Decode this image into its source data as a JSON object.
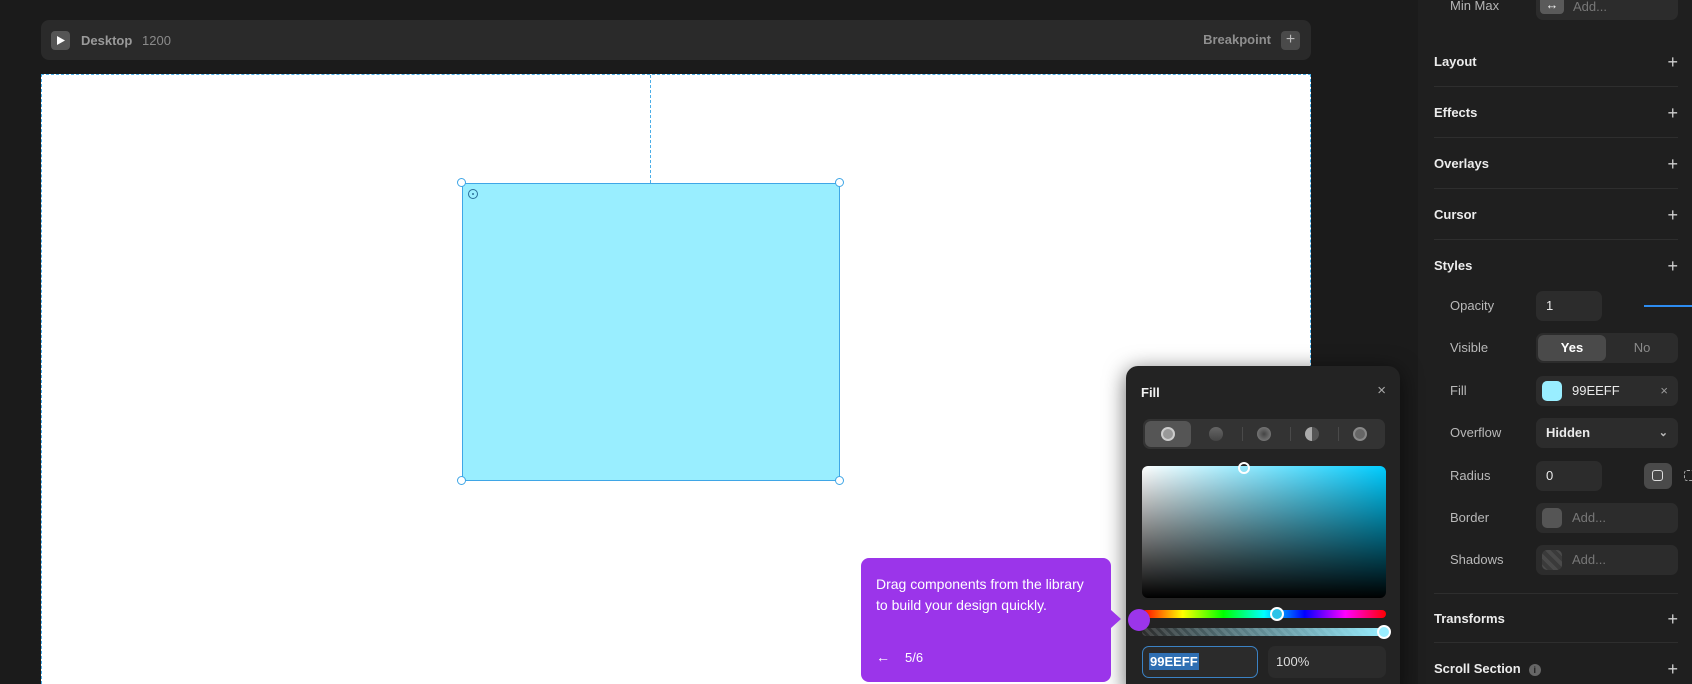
{
  "breakpoint_bar": {
    "title": "Desktop",
    "width": "1200",
    "breakpoint_label": "Breakpoint",
    "add_label": "+"
  },
  "panel": {
    "minmax": {
      "label": "Min Max",
      "placeholder": "Add..."
    },
    "sections": [
      {
        "title": "Layout"
      },
      {
        "title": "Effects"
      },
      {
        "title": "Overlays"
      },
      {
        "title": "Cursor"
      },
      {
        "title": "Styles"
      },
      {
        "title": "Transforms"
      },
      {
        "title": "Scroll Section"
      }
    ],
    "plus": "+",
    "info": "i",
    "styles": {
      "opacity": {
        "label": "Opacity",
        "value": "1",
        "level": 1
      },
      "visible": {
        "label": "Visible",
        "yes": "Yes",
        "no": "No"
      },
      "fill": {
        "label": "Fill",
        "value": "99EEFF",
        "clear": "×",
        "color": "#99EEFF"
      },
      "overflow": {
        "label": "Overflow",
        "value": "Hidden"
      },
      "radius": {
        "label": "Radius",
        "value": "0"
      },
      "border": {
        "label": "Border",
        "placeholder": "Add..."
      },
      "shadows": {
        "label": "Shadows",
        "placeholder": "Add..."
      }
    }
  },
  "fill_popover": {
    "title": "Fill",
    "close": "×",
    "hex": "99EEFF",
    "alpha": "100%",
    "hue_color": "#00CCFF"
  },
  "tooltip": {
    "text": "Drag components from the library to build your design quickly.",
    "back": "←",
    "step": "5/6"
  },
  "colors": {
    "accent": "#3FA6E6",
    "tooltip": "#9B35EA",
    "frame_fill": "#99EEFF"
  }
}
